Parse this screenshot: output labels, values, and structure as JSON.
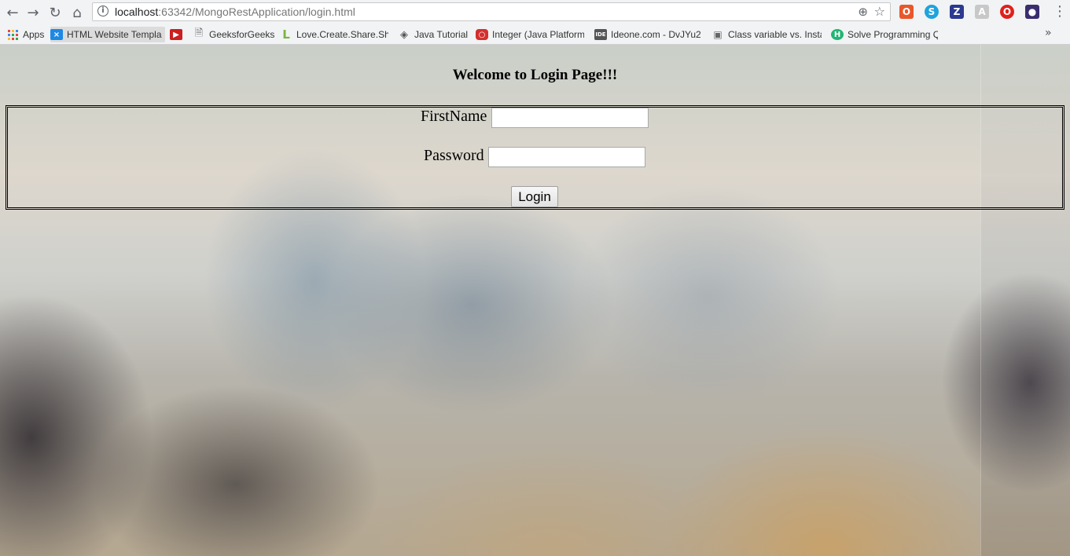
{
  "browser": {
    "url_host": "localhost",
    "url_path": ":63342/MongoRestApplication/login.html",
    "bookmarks": [
      {
        "label": "Apps",
        "icon": "apps-grid-icon"
      },
      {
        "label": "HTML Website Templa",
        "icon": "html-templates-icon"
      },
      {
        "label": "",
        "icon": "youtube-icon"
      },
      {
        "label": "GeeksforGeeks",
        "icon": "page-icon"
      },
      {
        "label": "Love.Create.Share.Sho",
        "icon": "l-logo-icon"
      },
      {
        "label": "Java Tutorial",
        "icon": "java-diamond-icon"
      },
      {
        "label": "Integer (Java Platform",
        "icon": "oracle-icon"
      },
      {
        "label": "Ideone.com - DvJYu2",
        "icon": "ideone-icon"
      },
      {
        "label": "Class variable vs. Insta",
        "icon": "laptop-icon"
      },
      {
        "label": "Solve Programming Q",
        "icon": "hackerearth-icon"
      }
    ]
  },
  "page": {
    "heading": "Welcome to Login Page!!!",
    "form": {
      "firstname_label": "FirstName",
      "firstname_value": "",
      "password_label": "Password",
      "password_value": "",
      "submit_label": "Login"
    }
  }
}
